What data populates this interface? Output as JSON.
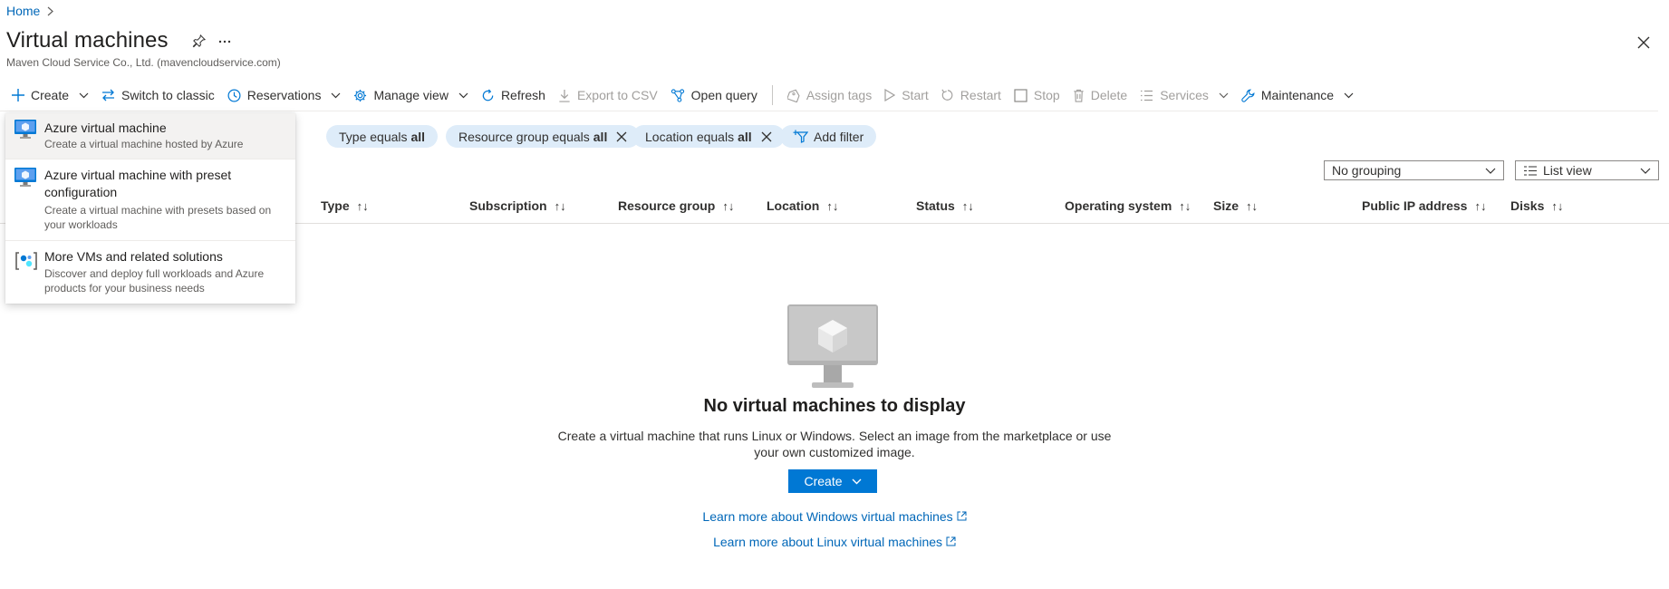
{
  "breadcrumb": {
    "home": "Home"
  },
  "page": {
    "title": "Virtual machines",
    "subtitle": "Maven Cloud Service Co., Ltd. (mavencloudservice.com)"
  },
  "toolbar": {
    "create": "Create",
    "switch_classic": "Switch to classic",
    "reservations": "Reservations",
    "manage_view": "Manage view",
    "refresh": "Refresh",
    "export_csv": "Export to CSV",
    "open_query": "Open query",
    "assign_tags": "Assign tags",
    "start": "Start",
    "restart": "Restart",
    "stop": "Stop",
    "delete": "Delete",
    "services": "Services",
    "maintenance": "Maintenance"
  },
  "filters": {
    "type_label": "Type equals",
    "type_value": "all",
    "rg_label": "Resource group equals",
    "rg_value": "all",
    "location_label": "Location equals",
    "location_value": "all",
    "add_filter": "Add filter"
  },
  "view": {
    "grouping": "No grouping",
    "view_mode": "List view"
  },
  "table": {
    "columns": [
      "Type",
      "Subscription",
      "Resource group",
      "Location",
      "Status",
      "Operating system",
      "Size",
      "Public IP address",
      "Disks"
    ],
    "sort_glyph": "↑↓"
  },
  "empty_state": {
    "title": "No virtual machines to display",
    "description": "Create a virtual machine that runs Linux or Windows. Select an image from the marketplace or use your own customized image.",
    "create_button": "Create",
    "learn_windows": "Learn more about Windows virtual machines",
    "learn_linux": "Learn more about Linux virtual machines"
  },
  "create_menu": {
    "items": [
      {
        "title": "Azure virtual machine",
        "description": "Create a virtual machine hosted by Azure",
        "icon": "vm-monitor-icon"
      },
      {
        "title": "Azure virtual machine with preset configuration",
        "description": "Create a virtual machine with presets based on your workloads",
        "icon": "vm-preset-icon"
      },
      {
        "title": "More VMs and related solutions",
        "description": "Discover and deploy full workloads and Azure products for your business needs",
        "icon": "solutions-icon"
      }
    ]
  },
  "colors": {
    "accent": "#0078d4",
    "link": "#0067b8",
    "pill_bg": "#deecf9",
    "menu_hover": "#f3f2f1"
  }
}
